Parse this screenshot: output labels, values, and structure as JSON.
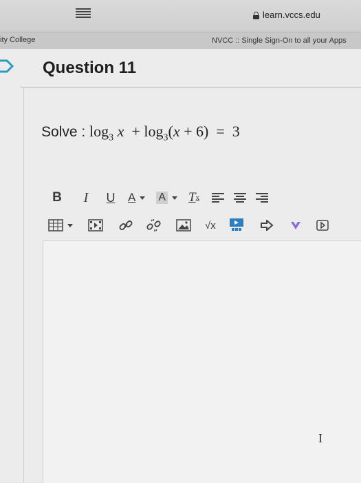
{
  "browser": {
    "url": "learn.vccs.edu",
    "tab_left": "ity College",
    "tab_right": "NVCC :: Single Sign-On to all your Apps"
  },
  "question": {
    "title": "Question 11",
    "prompt_label": "Solve :",
    "equation": {
      "log": "log",
      "base": "3",
      "x": "x",
      "plus": "+",
      "open": "(",
      "x_inner": "x",
      "plus6": "+ 6",
      "close": ")",
      "equals": "=",
      "rhs": "3"
    }
  },
  "toolbar": {
    "bold": "B",
    "italic": "I",
    "underline": "U",
    "text_color": "A",
    "bg_color": "A",
    "clear_format": "T",
    "clear_sub": "x",
    "sqrt": "√x"
  },
  "colors": {
    "accent_teal": "#2e9bbf",
    "link_purple": "#8a6bd6",
    "chrome": "#d3d3d3"
  }
}
